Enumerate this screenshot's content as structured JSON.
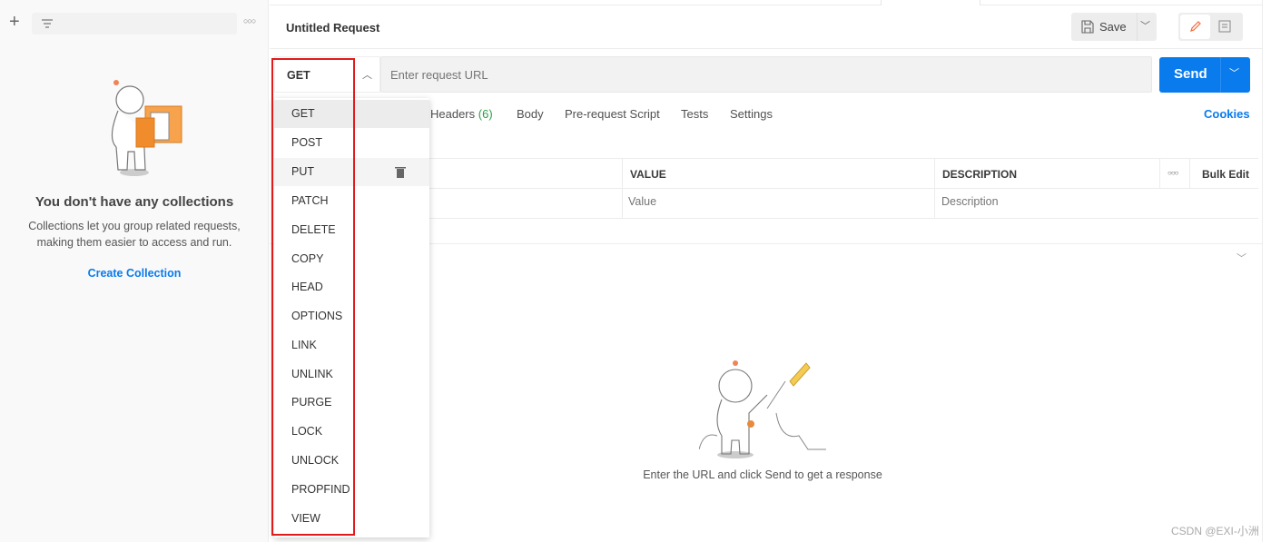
{
  "sidebar": {
    "empty_title": "You don't have any collections",
    "empty_desc_1": "Collections let you group related requests,",
    "empty_desc_2": "making them easier to access and run.",
    "create_link": "Create Collection"
  },
  "header": {
    "title": "Untitled Request",
    "save_label": "Save"
  },
  "request": {
    "method": "GET",
    "url_placeholder": "Enter request URL",
    "send_label": "Send"
  },
  "tabs": [
    {
      "label": "Headers",
      "count": "(6)"
    },
    {
      "label": "Body"
    },
    {
      "label": "Pre-request Script"
    },
    {
      "label": "Tests"
    },
    {
      "label": "Settings"
    }
  ],
  "cookies_label": "Cookies",
  "table": {
    "headers": [
      "VALUE",
      "DESCRIPTION"
    ],
    "bulk_edit": "Bulk Edit",
    "value_placeholder": "Value",
    "description_placeholder": "Description"
  },
  "methods": [
    "GET",
    "POST",
    "PUT",
    "PATCH",
    "DELETE",
    "COPY",
    "HEAD",
    "OPTIONS",
    "LINK",
    "UNLINK",
    "PURGE",
    "LOCK",
    "UNLOCK",
    "PROPFIND",
    "VIEW"
  ],
  "response": {
    "hint": "Enter the URL and click Send to get a response"
  },
  "watermark": "CSDN @EXI-小洲",
  "colors": {
    "accent": "#097bed",
    "highlight": "#e01b1b",
    "count": "#2a9e46"
  }
}
